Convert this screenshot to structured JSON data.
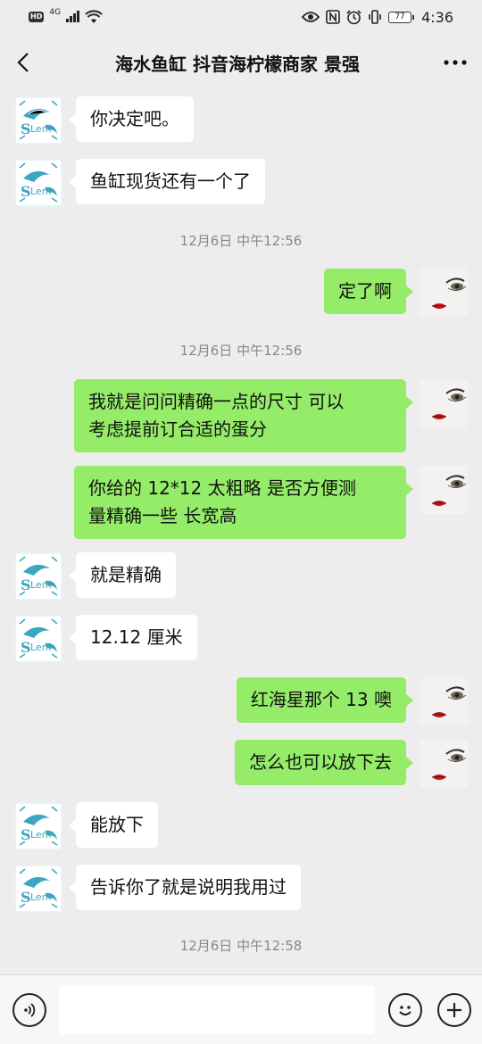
{
  "status_bar": {
    "hd": "HD",
    "network": "4G",
    "battery": "77",
    "time": "4:36"
  },
  "header": {
    "title": "海水鱼缸 抖音海柠檬商家 景强",
    "back_icon": "chevron-left-icon",
    "more_icon": "more-dots-icon"
  },
  "messages": [
    {
      "side": "left",
      "text": "你决定吧。"
    },
    {
      "side": "left",
      "text": "鱼缸现货还有一个了"
    },
    {
      "type": "time",
      "text": "12月6日 中午12:56"
    },
    {
      "side": "right",
      "text": "定了啊"
    },
    {
      "type": "time",
      "text": "12月6日 中午12:56"
    },
    {
      "side": "right",
      "text": "我就是问问精确一点的尺寸 可以\n考虑提前订合适的蛋分"
    },
    {
      "side": "right",
      "text": "你给的 12*12 太粗略 是否方便测\n量精确一些 长宽高"
    },
    {
      "side": "left",
      "text": "就是精确"
    },
    {
      "side": "left",
      "text": "12.12 厘米"
    },
    {
      "side": "right",
      "text": "红海星那个 13 噢"
    },
    {
      "side": "right",
      "text": "怎么也可以放下去"
    },
    {
      "side": "left",
      "text": "能放下"
    },
    {
      "side": "left",
      "text": "告诉你了就是说明我用过"
    },
    {
      "type": "time",
      "text": "12月6日 中午12:58"
    }
  ],
  "input_bar": {
    "input_value": "",
    "voice_icon": "voice-icon",
    "emoji_icon": "emoji-icon",
    "plus_icon": "plus-icon"
  },
  "colors": {
    "background": "#ededed",
    "own_bubble": "#95ec69",
    "other_bubble": "#ffffff",
    "timestamp": "#888888"
  }
}
